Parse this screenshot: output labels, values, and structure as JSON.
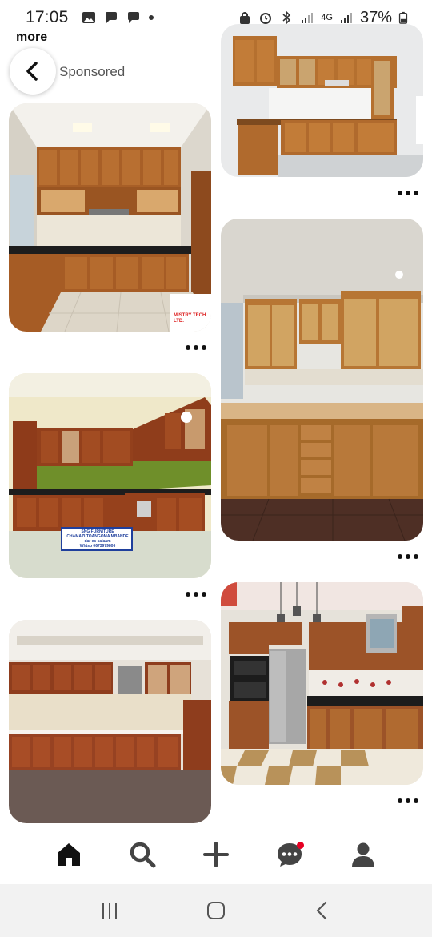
{
  "status_bar": {
    "time": "17:05",
    "network": "4G",
    "battery": "37%"
  },
  "header": {
    "more_label": "more",
    "sponsored_label": "Sponsored"
  },
  "pins": [
    {
      "label": "kitchen-pin-1",
      "watermark": "MISTRY TECH LTD."
    },
    {
      "label": "kitchen-pin-2",
      "sign_lines": [
        "SNG FURNITURE",
        "CHAMAZI TOANGOMA MBANDE",
        "dar es salaam",
        "Whtsp 0673979806"
      ]
    },
    {
      "label": "kitchen-pin-3"
    },
    {
      "label": "kitchen-pin-4"
    },
    {
      "label": "kitchen-pin-5"
    },
    {
      "label": "kitchen-pin-6"
    }
  ],
  "bottom_nav": {
    "items": [
      "home-icon",
      "search-icon",
      "create-icon",
      "messages-icon",
      "profile-icon"
    ]
  },
  "system_nav": {
    "items": [
      "recent-apps-icon",
      "home-button-icon",
      "back-nav-icon"
    ]
  },
  "colors": {
    "accent": "#e60023",
    "wood": "#b5702f"
  }
}
